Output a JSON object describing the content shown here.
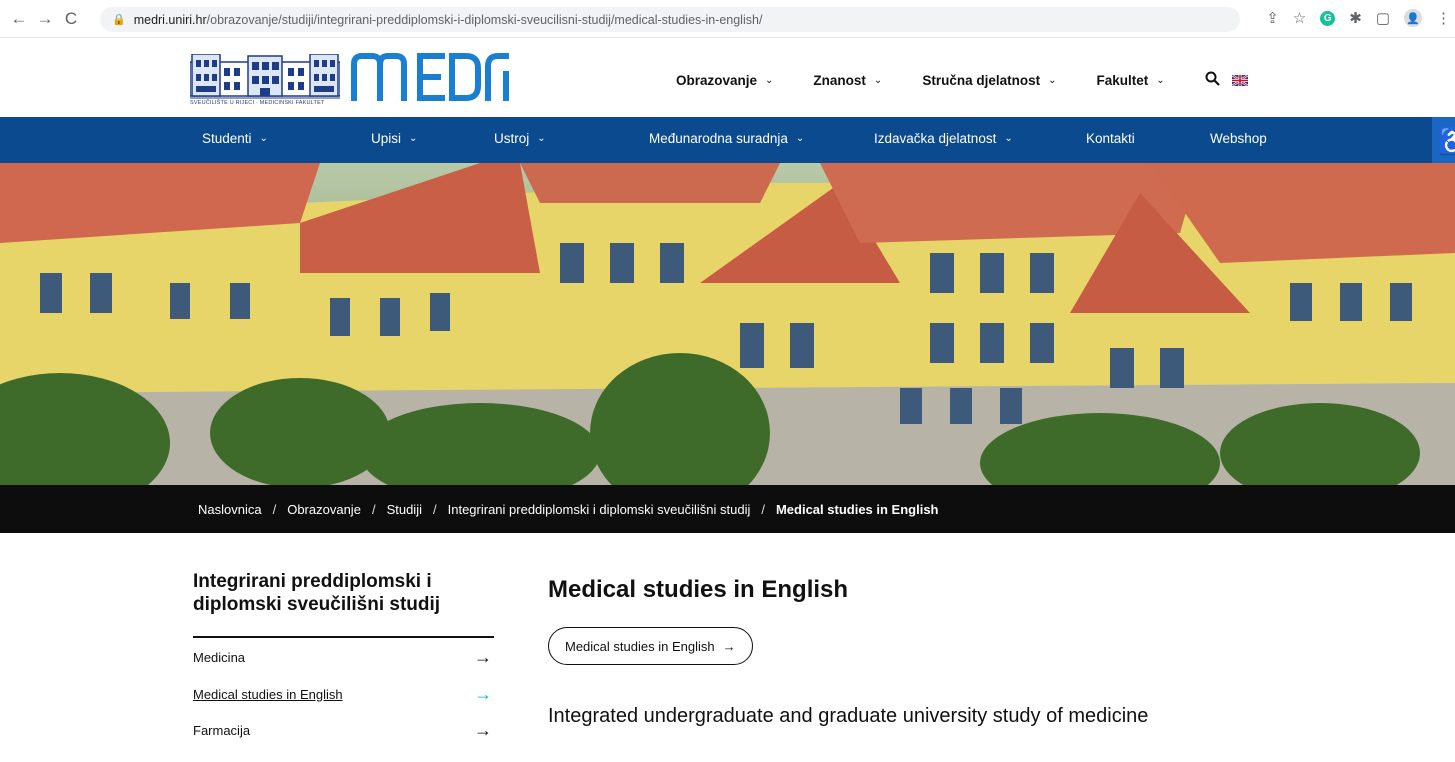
{
  "browser": {
    "url_domain": "medri.uniri.hr",
    "url_path": "/obrazovanje/studiji/integrirani-preddiplomski-i-diplomski-sveucilisni-studij/medical-studies-in-english/",
    "back_icon": "←",
    "forward_icon": "→",
    "reload_icon": "C",
    "grammarly_ext": "G"
  },
  "header": {
    "logo_text": "MEDRI",
    "logo_caption": "SVEUČILIŠTE U RIJECI · MEDICINSKI FAKULTET",
    "top_nav": [
      {
        "label": "Obrazovanje"
      },
      {
        "label": "Znanost"
      },
      {
        "label": "Stručna djelatnost"
      },
      {
        "label": "Fakultet"
      }
    ]
  },
  "main_nav": [
    {
      "label": "Studenti",
      "has_dropdown": true
    },
    {
      "label": "Upisi",
      "has_dropdown": true
    },
    {
      "label": "Ustroj",
      "has_dropdown": true
    },
    {
      "label": "Međunarodna suradnja",
      "has_dropdown": true
    },
    {
      "label": "Izdavačka djelatnost",
      "has_dropdown": true
    },
    {
      "label": "Kontakti",
      "has_dropdown": false
    },
    {
      "label": "Webshop",
      "has_dropdown": false
    }
  ],
  "breadcrumb": {
    "items": [
      "Naslovnica",
      "Obrazovanje",
      "Studiji",
      "Integrirani preddiplomski i diplomski sveučilišni studij"
    ],
    "current": "Medical studies in English",
    "separator": "/"
  },
  "sidebar": {
    "title": "Integrirani preddiplomski i diplomski sveučilišni studij",
    "items": [
      {
        "label": "Medicina",
        "active": false
      },
      {
        "label": "Medical studies in English",
        "active": true
      },
      {
        "label": "Farmacija",
        "active": false
      }
    ]
  },
  "main": {
    "title": "Medical studies in English",
    "button_label": "Medical studies in English",
    "subheading": "Integrated undergraduate and graduate university study of medicine"
  },
  "colors": {
    "nav_blue": "#0b4a8f",
    "logo_blue": "#1a7fd0",
    "breadcrumb_bg": "#0d0d0d",
    "active_arrow": "#1aa9d6"
  }
}
